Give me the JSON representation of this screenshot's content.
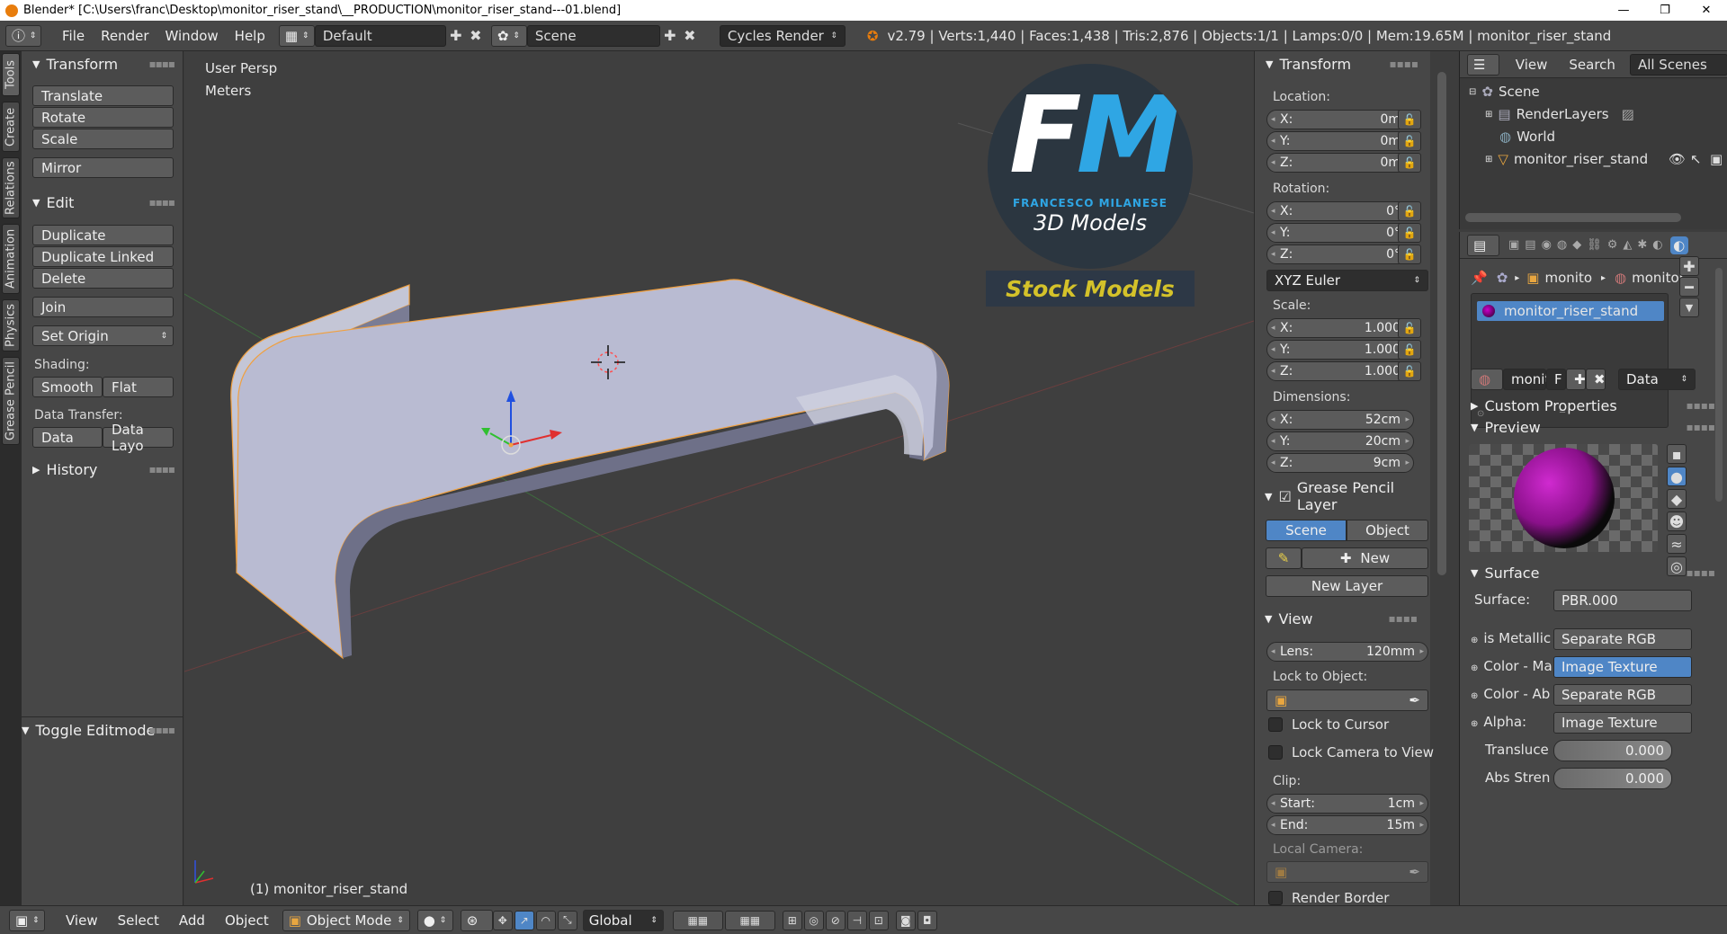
{
  "titlebar": {
    "title": "Blender* [C:\\Users\\franc\\Desktop\\monitor_riser_stand\\__PRODUCTION\\monitor_riser_stand---01.blend]"
  },
  "header": {
    "menus": [
      "File",
      "Render",
      "Window",
      "Help"
    ],
    "screen_layout": "Default",
    "scene": "Scene",
    "render_engine": "Cycles Render",
    "stats": "v2.79 | Verts:1,440 | Faces:1,438 | Tris:2,876 | Objects:1/1 | Lamps:0/0 | Mem:19.65M | monitor_riser_stand"
  },
  "tabs": [
    "Tools",
    "Create",
    "Relations",
    "Animation",
    "Physics",
    "Grease Pencil"
  ],
  "toolshelf": {
    "transform_title": "Transform",
    "translate": "Translate",
    "rotate": "Rotate",
    "scale": "Scale",
    "mirror": "Mirror",
    "edit_title": "Edit",
    "duplicate": "Duplicate",
    "duplicate_linked": "Duplicate Linked",
    "delete": "Delete",
    "join": "Join",
    "set_origin": "Set Origin",
    "shading_label": "Shading:",
    "smooth": "Smooth",
    "flat": "Flat",
    "data_transfer_label": "Data Transfer:",
    "data": "Data",
    "data_layout": "Data Layo",
    "history_title": "History",
    "toggle_editmode": "Toggle Editmode"
  },
  "viewport": {
    "view_name": "User Persp",
    "units": "Meters",
    "object_label": "(1) monitor_riser_stand",
    "watermark": {
      "initials_f": "F",
      "initials_m": "M",
      "author": "FRANCESCO MILANESE",
      "sub": "3D Models",
      "banner": "Stock Models"
    }
  },
  "npanel": {
    "transform_title": "Transform",
    "location_label": "Location:",
    "loc_x": "0m",
    "loc_y": "0m",
    "loc_z": "0m",
    "rotation_label": "Rotation:",
    "rot_x": "0°",
    "rot_y": "0°",
    "rot_z": "0°",
    "rotation_mode": "XYZ Euler",
    "scale_label": "Scale:",
    "scale_x": "1.000",
    "scale_y": "1.000",
    "scale_z": "1.000",
    "dimensions_label": "Dimensions:",
    "dim_x": "52cm",
    "dim_y": "20cm",
    "dim_z": "9cm",
    "axis_x": "X:",
    "axis_y": "Y:",
    "axis_z": "Z:",
    "gp_title": "Grease Pencil Layer",
    "gp_scene": "Scene",
    "gp_object": "Object",
    "gp_new": "New",
    "gp_new_layer": "New Layer",
    "view_title": "View",
    "lens_label": "Lens:",
    "lens": "120mm",
    "lock_object_label": "Lock to Object:",
    "lock_cursor": "Lock to Cursor",
    "lock_camera": "Lock Camera to View",
    "clip_label": "Clip:",
    "clip_start_label": "Start:",
    "clip_start": "1cm",
    "clip_end_label": "End:",
    "clip_end": "15m",
    "local_camera_label": "Local Camera:",
    "render_border": "Render Border"
  },
  "outliner": {
    "view": "View",
    "search": "Search",
    "all_scenes": "All Scenes",
    "items": [
      "Scene",
      "RenderLayers",
      "World",
      "monitor_riser_stand"
    ]
  },
  "properties": {
    "breadcrumb_object": "monito",
    "breadcrumb_material": "monitor",
    "material_slot": "monitor_riser_stand",
    "mat_name": "monit",
    "mat_f": "F",
    "mat_data": "Data",
    "custom_properties": "Custom Properties",
    "preview": "Preview",
    "surface_title": "Surface",
    "surface_label": "Surface:",
    "surface_value": "PBR.000",
    "rows": [
      {
        "label": "is Metallic",
        "value": "Separate RGB"
      },
      {
        "label": "Color - Ma",
        "value": "Image Texture"
      },
      {
        "label": "Color - Ab",
        "value": "Separate RGB"
      },
      {
        "label": "Alpha:",
        "value": "Image Texture"
      }
    ],
    "translucent_label": "Transluce",
    "translucent_value": "0.000",
    "abs_label": "Abs Stren",
    "abs_value": "0.000"
  },
  "footer": {
    "menus": [
      "View",
      "Select",
      "Add",
      "Object"
    ],
    "mode": "Object Mode",
    "orientation": "Global"
  },
  "colors": {
    "accent": "#4f86c6",
    "selection_outline": "#f0a040",
    "object_color": "#b7b9d0",
    "banner_text": "#d4c22a"
  }
}
